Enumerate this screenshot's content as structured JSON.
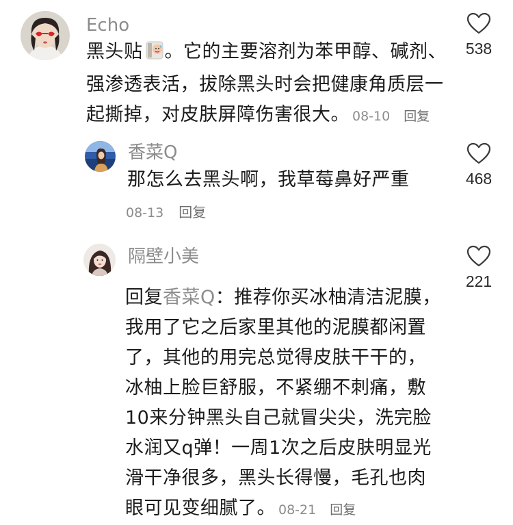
{
  "comments": [
    {
      "username": "Echo",
      "avatar": "avatar-girl-red-heart-sunglasses",
      "lines": [
        "黑头贴",
        "。它的主要溶剂为苯甲醇、碱剂、",
        "强渗透表活，拔除黑头时会把健康角质层一",
        "起撕掉，对皮肤屏障伤害很大。"
      ],
      "sticker": "sweating-face-emoji",
      "date": "08-10",
      "reply_label": "回复",
      "likes": "538"
    },
    {
      "username": "香菜Q",
      "avatar": "avatar-girl-blue-scenery",
      "lines": [
        "那怎么去黑头啊，我草莓鼻好严重"
      ],
      "date": "08-13",
      "reply_label": "回复",
      "likes": "468"
    },
    {
      "username": "隔壁小美",
      "avatar": "avatar-girl-portrait",
      "reply_prefix": "回复",
      "mention": "香菜Q",
      "lines": [
        "：推荐你买冰柚清洁泥膜，",
        "我用了它之后家里其他的泥膜都闲置",
        "了，其他的用完总觉得皮肤干干的，",
        "冰柚上脸巨舒服，不紧绷不刺痛，敷",
        "10来分钟黑头自己就冒尖尖，洗完脸",
        "水润又q弹！一周1次之后皮肤明显光",
        "滑干净很多，黑头长得慢，毛孔也肉",
        "眼可见变细腻了。"
      ],
      "date": "08-21",
      "reply_label": "回复",
      "likes": "221"
    }
  ],
  "icons": {
    "like": "heart-outline-icon"
  }
}
